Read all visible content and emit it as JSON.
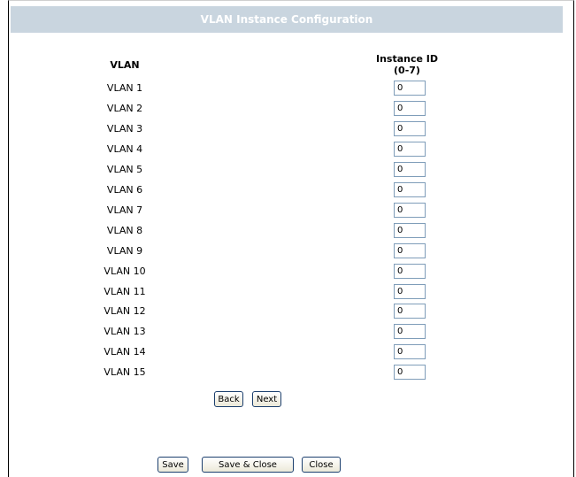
{
  "page": {
    "title": "VLAN Instance Configuration"
  },
  "table": {
    "col_vlan": "VLAN",
    "col_instance": "Instance ID",
    "col_instance_range": "(0-7)",
    "rows": [
      {
        "vlan": "VLAN 1",
        "instance": "0"
      },
      {
        "vlan": "VLAN 2",
        "instance": "0"
      },
      {
        "vlan": "VLAN 3",
        "instance": "0"
      },
      {
        "vlan": "VLAN 4",
        "instance": "0"
      },
      {
        "vlan": "VLAN 5",
        "instance": "0"
      },
      {
        "vlan": "VLAN 6",
        "instance": "0"
      },
      {
        "vlan": "VLAN 7",
        "instance": "0"
      },
      {
        "vlan": "VLAN 8",
        "instance": "0"
      },
      {
        "vlan": "VLAN 9",
        "instance": "0"
      },
      {
        "vlan": "VLAN 10",
        "instance": "0"
      },
      {
        "vlan": "VLAN 11",
        "instance": "0"
      },
      {
        "vlan": "VLAN 12",
        "instance": "0"
      },
      {
        "vlan": "VLAN 13",
        "instance": "0"
      },
      {
        "vlan": "VLAN 14",
        "instance": "0"
      },
      {
        "vlan": "VLAN 15",
        "instance": "0"
      }
    ]
  },
  "pager": {
    "back_label": "Back",
    "next_label": "Next"
  },
  "footer": {
    "save_label": "Save",
    "save_close_label": "Save & Close",
    "close_label": "Close"
  }
}
